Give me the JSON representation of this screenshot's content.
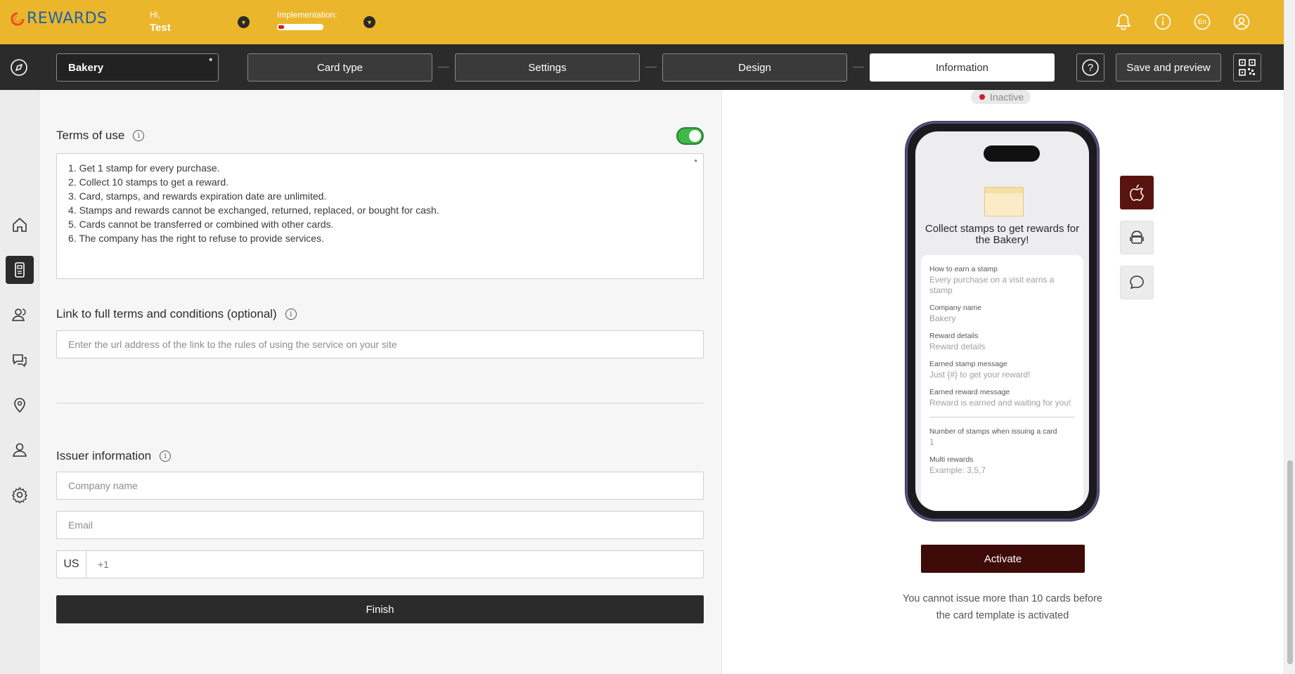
{
  "header": {
    "logo_text": "REWARDS",
    "greeting": "Hi,",
    "user_name": "Test",
    "implementation_label": "Implementation:",
    "implementation_progress": 0.12,
    "language": "En"
  },
  "toolbar": {
    "card_name": "Bakery",
    "card_name_required": "*",
    "steps": [
      "Card type",
      "Settings",
      "Design",
      "Information"
    ],
    "active_step": "Information",
    "help_symbol": "?",
    "save_label": "Save and preview"
  },
  "form": {
    "terms_label": "Terms of use",
    "terms_enabled": true,
    "terms_required": "*",
    "terms_lines": [
      "1. Get 1 stamp for every purchase.",
      "2. Collect 10 stamps to get a reward.",
      "3. Card, stamps, and rewards expiration date are unlimited.",
      "4. Stamps and rewards cannot be exchanged, returned, replaced, or bought for cash.",
      "5. Cards cannot be transferred or combined with other cards.",
      "6. The company has the right to refuse to provide services."
    ],
    "link_label": "Link to full terms and conditions (optional)",
    "link_placeholder": "Enter the url address of the link to the rules of using the service on your site",
    "issuer_label": "Issuer information",
    "company_placeholder": "Company name",
    "email_placeholder": "Email",
    "phone_country": "US",
    "phone_prefix": "+1",
    "finish_label": "Finish"
  },
  "preview": {
    "status": "Inactive",
    "status_color": "#d21f2c",
    "title": "Collect stamps to get rewards for the Bakery!",
    "fields": [
      {
        "label": "How to earn a stamp",
        "value": "Every purchase on a visit earns a stamp"
      },
      {
        "label": "Company name",
        "value": "Bakery"
      },
      {
        "label": "Reward details",
        "value": "Reward details"
      },
      {
        "label": "Earned stamp message",
        "value": "Just {#} to get your reward!"
      },
      {
        "label": "Earned reward message",
        "value": "Reward is earned and waiting for you!"
      }
    ],
    "extra_fields": [
      {
        "label": "Number of stamps when issuing a card",
        "value": "1"
      },
      {
        "label": "Multi rewards",
        "value": "Example: 3,5,7"
      }
    ],
    "activate_label": "Activate",
    "notice": "You cannot issue more than 10 cards before the card template is activated"
  },
  "colors": {
    "header_bg": "#ebb62c",
    "nav_bg": "#2b2b2b",
    "toggle_on": "#3fb94a",
    "activate_bg": "#3e0b08",
    "platform_active": "#5a1410"
  },
  "icons": {
    "header": [
      "bell-icon",
      "info-icon",
      "language-icon",
      "user-circle-icon"
    ],
    "sidebar": [
      "home-icon",
      "card-reader-icon",
      "users-icon",
      "chat-icon",
      "location-pin-icon",
      "person-icon",
      "gear-icon"
    ],
    "preview_platforms": [
      "apple-icon",
      "android-icon",
      "message-icon"
    ]
  }
}
